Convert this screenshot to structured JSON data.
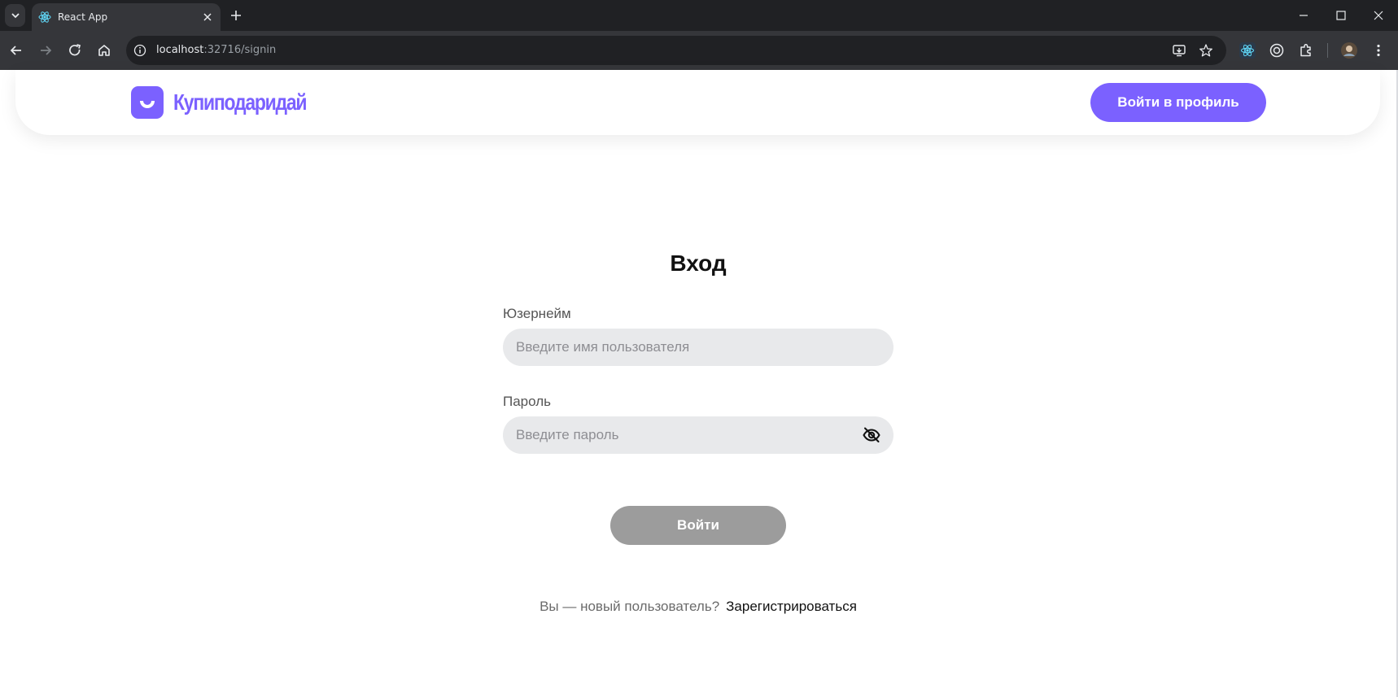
{
  "browser": {
    "tab_title": "React App",
    "url_host": "localhost",
    "url_path": ":32716/signin"
  },
  "header": {
    "logo_text": "Купиподаридай",
    "profile_button": "Войти в профиль"
  },
  "form": {
    "title": "Вход",
    "username_label": "Юзернейм",
    "username_placeholder": "Введите имя пользователя",
    "password_label": "Пароль",
    "password_placeholder": "Введите пароль",
    "submit_label": "Войти"
  },
  "signup": {
    "question": "Вы — новый пользователь?",
    "link": "Зарегистрироваться"
  },
  "colors": {
    "accent": "#7B61FF",
    "disabled_button": "#9c9c9c",
    "input_bg": "#e8e9eb"
  },
  "icons": [
    "tab-list-icon",
    "react-favicon-icon",
    "close-icon",
    "plus-icon",
    "minimize-icon",
    "maximize-icon",
    "window-close-icon",
    "back-icon",
    "forward-icon",
    "reload-icon",
    "home-icon",
    "info-icon",
    "install-icon",
    "star-icon",
    "react-devtools-icon",
    "extension-icon",
    "puzzle-icon",
    "avatar",
    "menu-icon",
    "logo-smile-icon",
    "eye-off-icon"
  ]
}
